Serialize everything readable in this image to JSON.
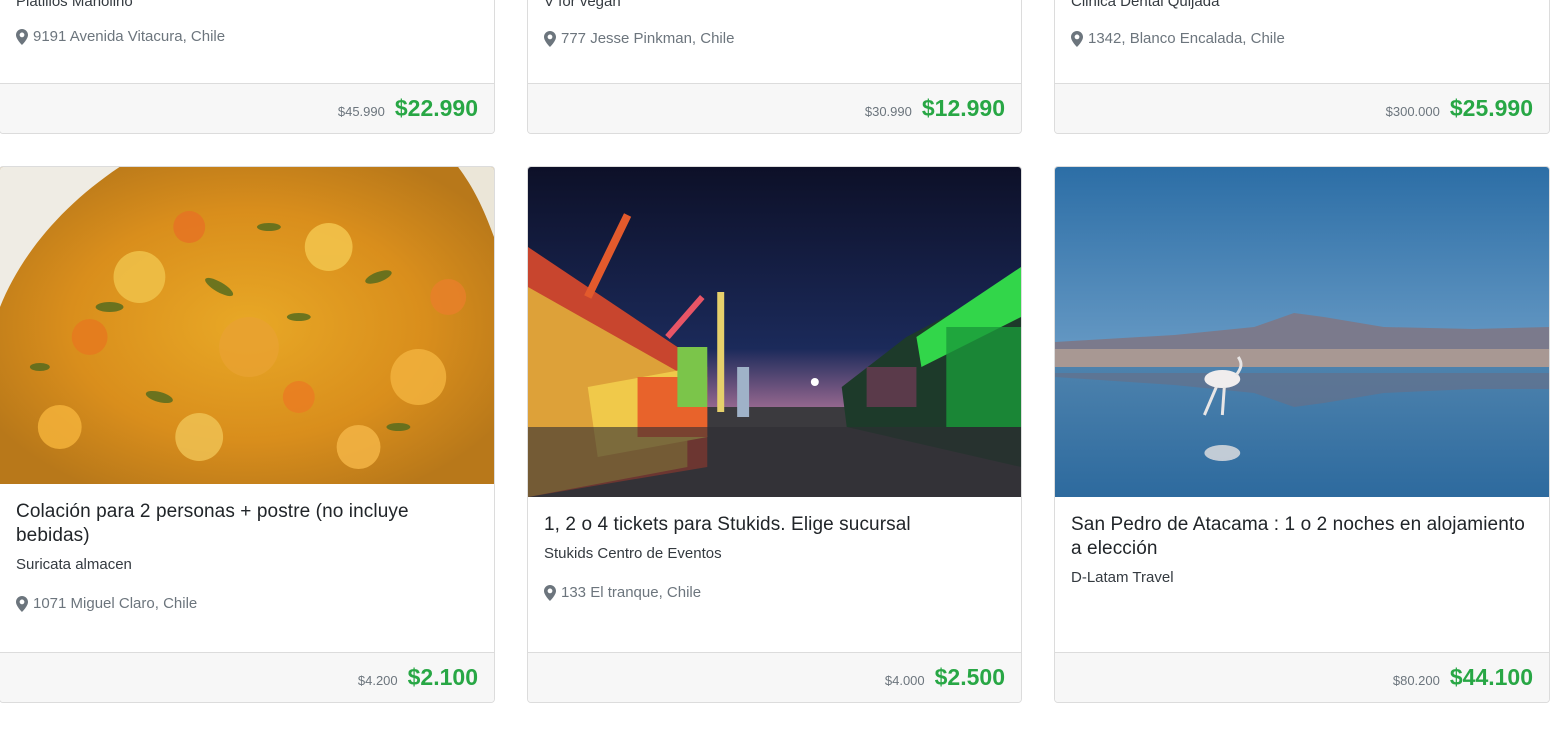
{
  "top_cards": [
    {
      "title": "Platillos Manolino",
      "location": "9191 Avenida Vitacura, Chile",
      "old_price": "$45.990",
      "price": "$22.990"
    },
    {
      "title": "V for vegan",
      "location": "777 Jesse Pinkman, Chile",
      "old_price": "$30.990",
      "price": "$12.990"
    },
    {
      "title": "Clinica Dental Quijada",
      "location": "1342, Blanco Encalada, Chile",
      "old_price": "$300.000",
      "price": "$25.990"
    }
  ],
  "cards": [
    {
      "title": "Colación para 2 personas + postre (no incluye bebidas)",
      "merchant": "Suricata almacen",
      "location": "1071 Miguel Claro, Chile",
      "old_price": "$4.200",
      "price": "$2.100",
      "image": "food-photo"
    },
    {
      "title": "1, 2 o 4 tickets para Stukids. Elige sucursal",
      "merchant": "Stukids Centro de Eventos",
      "location": "133 El tranque, Chile",
      "old_price": "$4.000",
      "price": "$2.500",
      "image": "fair-photo"
    },
    {
      "title": "San Pedro de Atacama : 1 o 2 noches en alojamiento a elección",
      "merchant": "D-Latam Travel",
      "old_price": "$80.200",
      "price": "$44.100",
      "image": "flamingo-photo"
    }
  ],
  "colors": {
    "price": "#28a745",
    "muted": "#6c757d",
    "footer_bg": "#f7f7f7"
  },
  "icons": {
    "location": "map-pin-icon"
  }
}
